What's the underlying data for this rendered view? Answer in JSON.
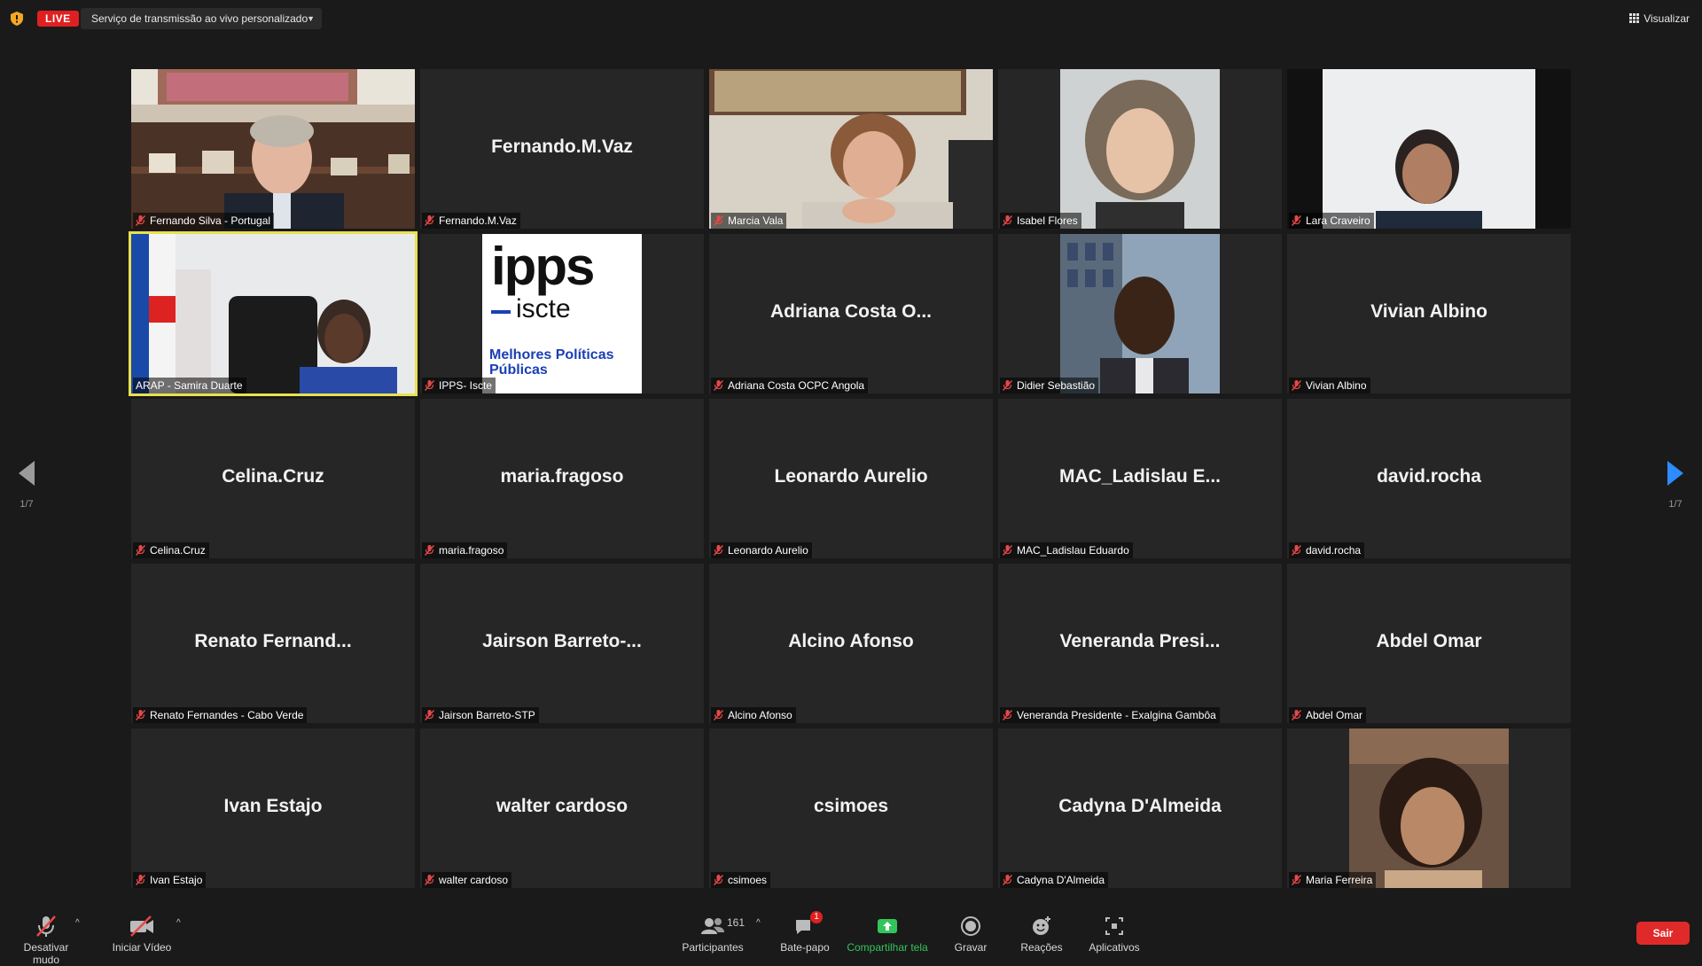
{
  "top_bar": {
    "live_label": "LIVE",
    "stream_service": "Serviço de transmissão ao vivo personalizado",
    "view_label": "Visualizar"
  },
  "pagination": {
    "left": "1/7",
    "right": "1/7"
  },
  "tiles": [
    {
      "label": "Fernando Silva - Portugal",
      "big": ""
    },
    {
      "label": "Fernando.M.Vaz",
      "big": "Fernando.M.Vaz"
    },
    {
      "label": "Marcia Vala",
      "big": ""
    },
    {
      "label": "Isabel Flores",
      "big": ""
    },
    {
      "label": "Lara Craveiro",
      "big": ""
    },
    {
      "label": "ARAP - Samira Duarte",
      "big": ""
    },
    {
      "label": "IPPS- Iscte",
      "big": ""
    },
    {
      "label": "Adriana Costa OCPC Angola",
      "big": "Adriana Costa O..."
    },
    {
      "label": "Didier Sebastião",
      "big": ""
    },
    {
      "label": "Vivian Albino",
      "big": "Vivian Albino"
    },
    {
      "label": "Celina.Cruz",
      "big": "Celina.Cruz"
    },
    {
      "label": "maria.fragoso",
      "big": "maria.fragoso"
    },
    {
      "label": "Leonardo Aurelio",
      "big": "Leonardo Aurelio"
    },
    {
      "label": "MAC_Ladislau Eduardo",
      "big": "MAC_Ladislau E..."
    },
    {
      "label": "david.rocha",
      "big": "david.rocha"
    },
    {
      "label": "Renato Fernandes - Cabo Verde",
      "big": "Renato  Fernand..."
    },
    {
      "label": "Jairson Barreto-STP",
      "big": "Jairson  Barreto-..."
    },
    {
      "label": "Alcino Afonso",
      "big": "Alcino Afonso"
    },
    {
      "label": "Veneranda Presidente  - Exalgina Gambôa",
      "big": "Veneranda  Presi..."
    },
    {
      "label": "Abdel Omar",
      "big": "Abdel Omar"
    },
    {
      "label": "Ivan Estajo",
      "big": "Ivan Estajo"
    },
    {
      "label": "walter cardoso",
      "big": "walter cardoso"
    },
    {
      "label": "csimoes",
      "big": "csimoes"
    },
    {
      "label": "Cadyna D'Almeida",
      "big": "Cadyna D'Almeida"
    },
    {
      "label": "Maria Ferreira",
      "big": ""
    }
  ],
  "ipps_logo": {
    "line1": "ipps",
    "line2": "iscte",
    "line3": "Melhores Políticas",
    "line4": "Públicas"
  },
  "bottom_bar": {
    "mute": "Desativar mudo",
    "video": "Iniciar Vídeo",
    "participants": "Participantes",
    "participants_count": "161",
    "chat": "Bate-papo",
    "chat_badge": "1",
    "share": "Compartilhar tela",
    "record": "Gravar",
    "reactions": "Reações",
    "apps": "Aplicativos",
    "leave": "Sair"
  },
  "colors": {
    "live": "#e02020",
    "active_speaker": "#e8e14f",
    "share_green": "#32c55a",
    "leave_red": "#e02a2a",
    "nav_arrow_right": "#2d8cff"
  }
}
